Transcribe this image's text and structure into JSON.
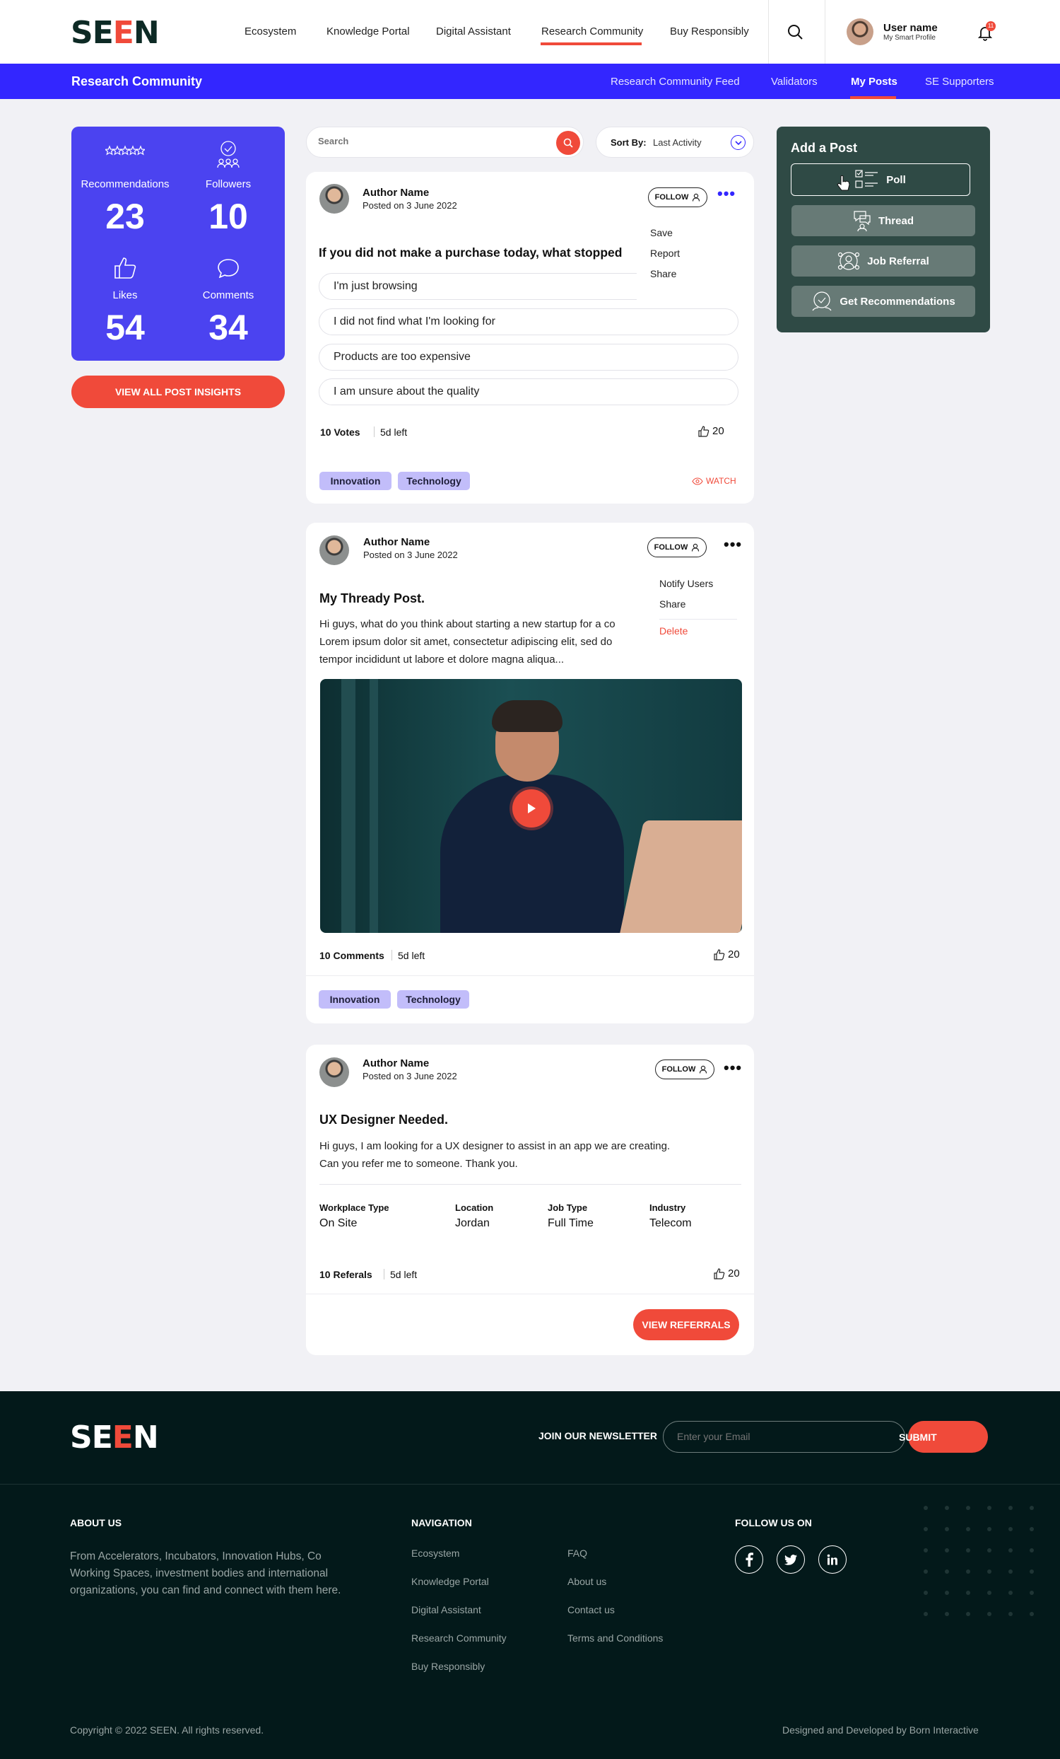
{
  "header": {
    "logo": "SEEN",
    "nav": [
      "Ecosystem",
      "Knowledge Portal",
      "Digital Assistant",
      "Research Community",
      "Buy Responsibly"
    ],
    "user_name": "User name",
    "user_sub": "My Smart Profile",
    "notifications": "11"
  },
  "subnav": {
    "title": "Research Community",
    "items": [
      "Research Community Feed",
      "Validators",
      "My Posts",
      "SE Supporters"
    ]
  },
  "stats": {
    "recommendations_label": "Recommendations",
    "recommendations": "23",
    "followers_label": "Followers",
    "followers": "10",
    "likes_label": "Likes",
    "likes": "54",
    "comments_label": "Comments",
    "comments": "34",
    "insights_button": "VIEW ALL POST INSIGHTS"
  },
  "search": {
    "placeholder": "Search",
    "sort_label": "Sort By:",
    "sort_value": "Last Activity"
  },
  "add_post": {
    "title": "Add a Post",
    "buttons": [
      "Poll",
      "Thread",
      "Job Referral",
      "Get Recommendations"
    ]
  },
  "posts": [
    {
      "author": "Author Name",
      "posted": "Posted on 3 June 2022",
      "follow": "FOLLOW",
      "menu": [
        "Save",
        "Report",
        "Share"
      ],
      "title": "If you did not make a purchase today, what stopped",
      "options": [
        "I'm just browsing",
        "I did not find what I'm looking for",
        "Products are too expensive",
        "I am unsure about the quality"
      ],
      "count": "10 Votes",
      "left": "5d left",
      "likes": "20",
      "tags": [
        "Innovation",
        "Technology"
      ],
      "watch": "WATCH"
    },
    {
      "author": "Author Name",
      "posted": "Posted on 3 June 2022",
      "follow": "FOLLOW",
      "menu": [
        "Notify Users",
        "Share",
        "Delete"
      ],
      "title": "My Thready Post.",
      "body": [
        "Hi guys, what do you think about starting a new startup for a co",
        "Lorem ipsum dolor sit amet, consectetur adipiscing elit, sed do",
        "tempor incididunt ut labore et dolore magna aliqua..."
      ],
      "count": "10 Comments",
      "left": "5d left",
      "likes": "20",
      "tags": [
        "Innovation",
        "Technology"
      ]
    },
    {
      "author": "Author Name",
      "posted": "Posted on 3 June 2022",
      "follow": "FOLLOW",
      "title": "UX Designer Needed.",
      "body": [
        "Hi guys, I am looking for a UX designer to assist in an app we are creating.",
        "Can you refer me to someone. Thank you."
      ],
      "fields": [
        {
          "label": "Workplace Type",
          "value": "On Site"
        },
        {
          "label": "Location",
          "value": "Jordan"
        },
        {
          "label": "Job Type",
          "value": "Full Time"
        },
        {
          "label": "Industry",
          "value": "Telecom"
        }
      ],
      "count": "10 Referals",
      "left": "5d left",
      "likes": "20",
      "button": "VIEW REFERRALS"
    }
  ],
  "footer": {
    "logo": "SEEN",
    "newsletter_label": "JOIN OUR NEWSLETTER",
    "email_placeholder": "Enter your Email",
    "submit": "SUBMIT",
    "about_title": "ABOUT US",
    "about_text": [
      "From Accelerators, Incubators, Innovation Hubs, Co",
      "Working Spaces, investment bodies and international",
      "organizations, you can find and connect with them here."
    ],
    "nav_title": "NAVIGATION",
    "nav_col1": [
      "Ecosystem",
      "Knowledge Portal",
      "Digital Assistant",
      "Research Community",
      "Buy Responsibly"
    ],
    "nav_col2": [
      "FAQ",
      "About us",
      "Contact us",
      "Terms and Conditions"
    ],
    "follow_title": "FOLLOW US ON",
    "copyright": "Copyright © 2022 SEEN. All rights reserved.",
    "credit": "Designed and Developed by Born Interactive"
  },
  "colors": {
    "accent": "#f04a3a",
    "brand_blue": "#3326ff",
    "dark": "#03191a",
    "panel": "#2f4a45"
  },
  "icons": [
    "search-icon",
    "bell-icon",
    "chevron-down-icon",
    "user-icon",
    "thumbs-up-icon",
    "eye-icon",
    "play-icon",
    "facebook-icon",
    "twitter-icon",
    "linkedin-icon",
    "stars-icon",
    "badge-icon",
    "comment-icon",
    "poll-icon",
    "thread-icon",
    "job-referral-icon",
    "recommendation-icon",
    "cursor-icon"
  ]
}
